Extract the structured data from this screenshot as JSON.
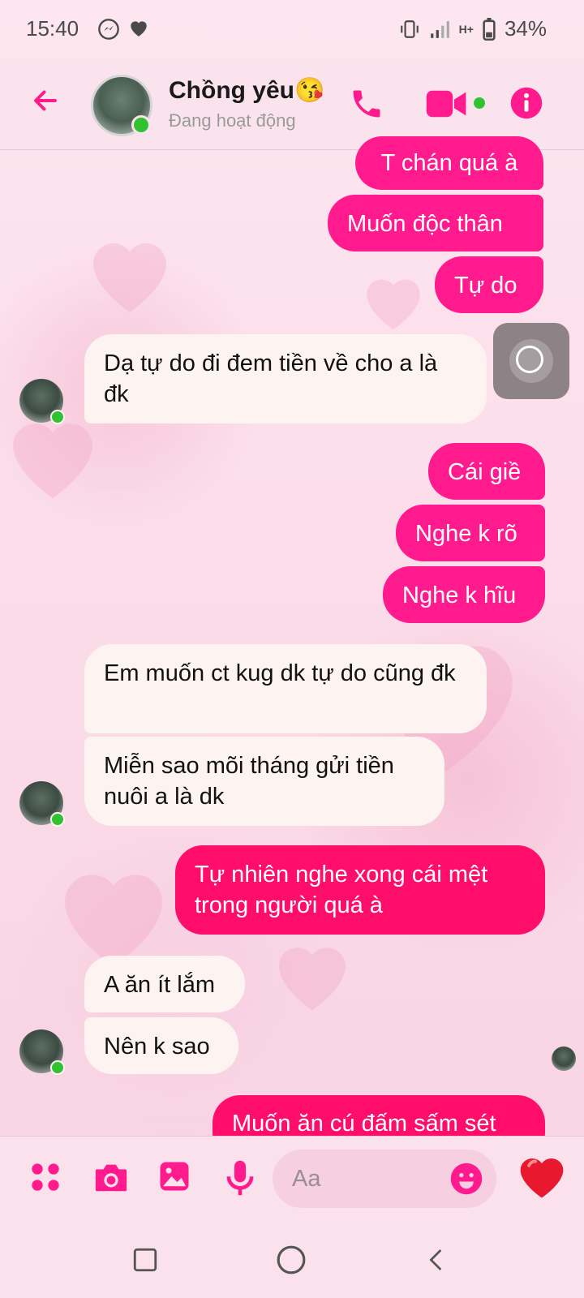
{
  "status_bar": {
    "time": "15:40",
    "battery": "34%",
    "network": "H+"
  },
  "header": {
    "name": "Chồng yêu😘",
    "status": "Đang hoạt động"
  },
  "messages": [
    {
      "from": "me",
      "text": "T chán quá à"
    },
    {
      "from": "me",
      "text": "Muốn độc thân"
    },
    {
      "from": "me",
      "text": "Tự do"
    },
    {
      "from": "them",
      "text": "Dạ tự do đi đem tiền về cho a là đk"
    },
    {
      "from": "me",
      "text": "Cái giề"
    },
    {
      "from": "me",
      "text": "Nghe k rõ"
    },
    {
      "from": "me",
      "text": "Nghe k hĩu"
    },
    {
      "from": "them",
      "text": "Em muốn ct kug dk tự do cũng đk"
    },
    {
      "from": "them",
      "text": "Miễn sao mõi tháng gửi tiền nuôi a là dk"
    },
    {
      "from": "me",
      "text": "Tự nhiên nghe xong cái mệt trong người quá à"
    },
    {
      "from": "them",
      "text": "A ăn ít lắm"
    },
    {
      "from": "them",
      "text": "Nên k sao"
    },
    {
      "from": "me",
      "text": "Muốn ăn cú đấm sấm sét"
    }
  ],
  "composer": {
    "placeholder": "Aa"
  },
  "colors": {
    "accent": "#ff1b8d",
    "bubble_me": "#ff1b8d",
    "bubble_them": "#fdf3f1",
    "online": "#31c232"
  }
}
